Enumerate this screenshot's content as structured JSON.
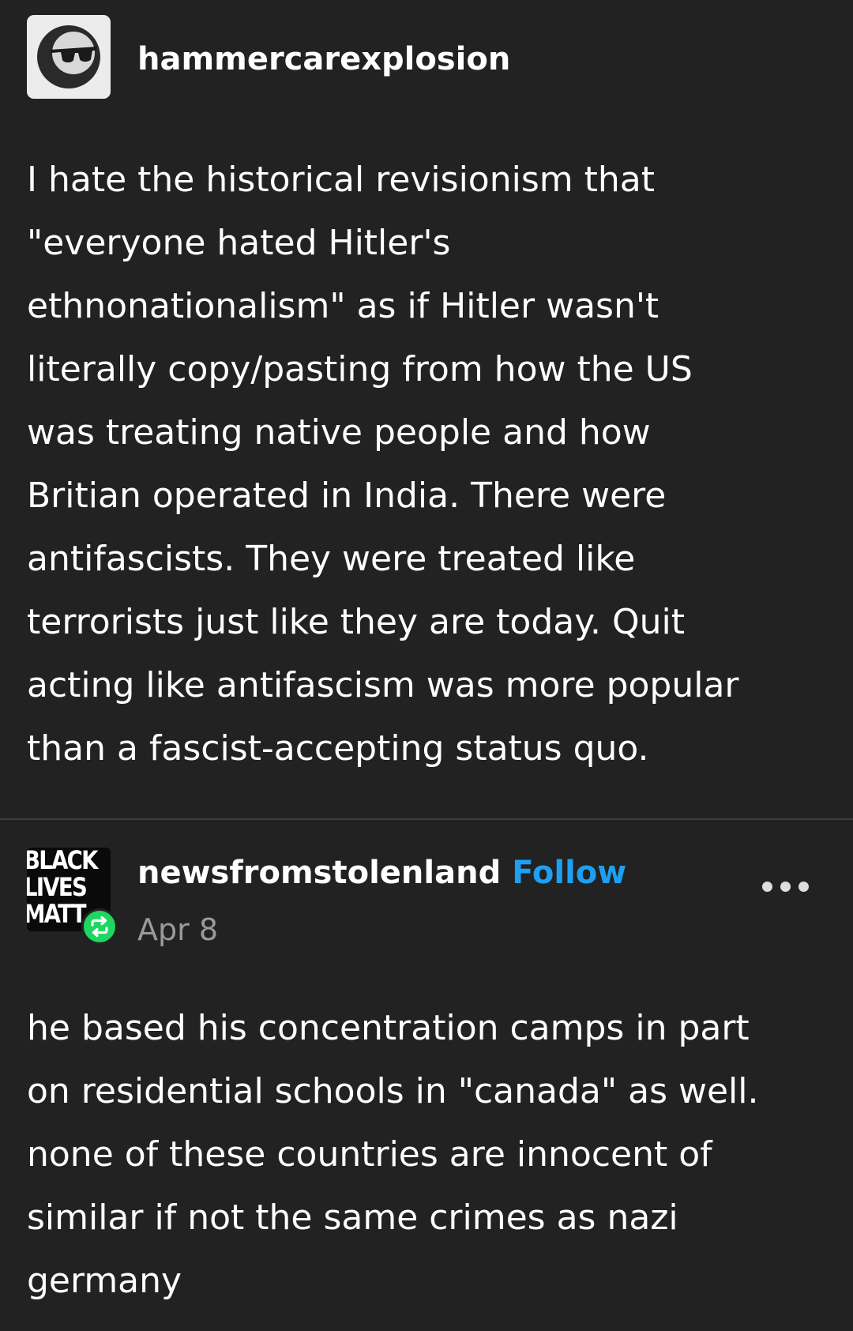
{
  "theme": {
    "background": "#222222",
    "text": "#ffffff",
    "follow_color": "#1ea0f2",
    "reblog_badge_color": "#1ed760",
    "muted_text": "#9a9a9a"
  },
  "posts": [
    {
      "username": "hammercarexplosion",
      "avatar_icon": "sunglasses-face-icon",
      "body_lines": [
        "I hate the historical revisionism that",
        "\"everyone hated Hitler's",
        "ethnonationalism\" as if Hitler wasn't",
        "literally copy/pasting from how the US",
        "was treating native people and how",
        "Britian operated in India. There were",
        "antifascists. They were treated like",
        "terrorists just like they are today. Quit",
        "acting like antifascism was more popular",
        "than a fascist-accepting status quo."
      ]
    },
    {
      "username": "newsfromstolenland",
      "follow_label": "Follow",
      "date": "Apr 8",
      "avatar_text": [
        "BLACK",
        "LIVES",
        "MATT"
      ],
      "avatar_badge_icon": "reblog-icon",
      "menu_icon": "more-options-icon",
      "body_lines": [
        "he based his concentration camps in part",
        "on residential schools in \"canada\" as well.",
        "none of these countries are innocent of",
        "similar if not the same crimes as nazi",
        "germany"
      ]
    }
  ]
}
